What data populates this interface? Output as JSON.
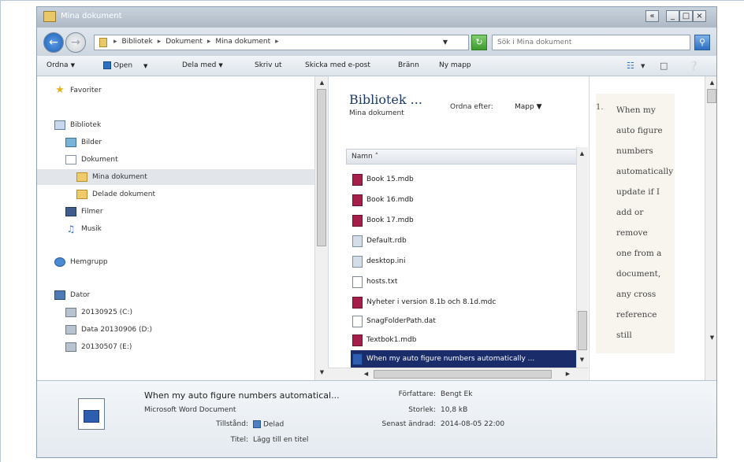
{
  "window": {
    "title": "Mina dokument",
    "buttons": {
      "extra": "«",
      "minimize": "_",
      "maximize": "□",
      "close": "×"
    }
  },
  "address": {
    "crumbs": [
      "Bibliotek",
      "Dokument",
      "Mina dokument"
    ],
    "separator": "▸",
    "dropdown": "▼",
    "search_placeholder": "Sök i Mina dokument"
  },
  "toolbar": {
    "organize": "Ordna",
    "open": "Open",
    "share": "Dela med",
    "print": "Skriv ut",
    "email": "Skicka med e-post",
    "burn": "Bränn",
    "new_folder": "Ny mapp",
    "arrow": "▼"
  },
  "nav": {
    "favorites": "Favoriter",
    "libraries": "Bibliotek",
    "pictures": "Bilder",
    "documents": "Dokument",
    "my_documents": "Mina dokument",
    "shared_documents": "Delade dokument",
    "videos": "Filmer",
    "music": "Musik",
    "homegroup": "Hemgrupp",
    "computer": "Dator",
    "drives": [
      "20130925 (C:)",
      "Data 20130906 (D:)",
      "20130507 (E:)"
    ]
  },
  "filelist": {
    "library_title": "Bibliotek ...",
    "library_subtitle": "Mina dokument",
    "arrange_label": "Ordna efter:",
    "arrange_value": "Mapp ▼",
    "column_name": "Namn",
    "sort_arrow": "˄",
    "files": [
      {
        "name": "Book 15.mdb",
        "type": "mdb"
      },
      {
        "name": "Book 16.mdb",
        "type": "mdb"
      },
      {
        "name": "Book 17.mdb",
        "type": "mdb"
      },
      {
        "name": "Default.rdb",
        "type": "ini"
      },
      {
        "name": "desktop.ini",
        "type": "ini"
      },
      {
        "name": "hosts.txt",
        "type": "txt"
      },
      {
        "name": "Nyheter i version 8.1b och 8.1d.mdc",
        "type": "mdb"
      },
      {
        "name": "SnagFolderPath.dat",
        "type": "dat"
      },
      {
        "name": "Textbok1.mdb",
        "type": "mdb"
      },
      {
        "name": "When my auto figure numbers automatically ...",
        "type": "doc"
      }
    ]
  },
  "preview": {
    "number": "1.",
    "lines": [
      "When my",
      "auto figure",
      "numbers",
      "automatically",
      "update if I",
      "add or",
      "remove",
      "one from a",
      "document,",
      "any cross",
      "reference",
      "still"
    ]
  },
  "details": {
    "name": "When my auto figure numbers automatical...",
    "type": "Microsoft Word Document",
    "shared_label": "Tillstånd:",
    "shared_value": "Delad",
    "title_label": "Titel:",
    "title_value": "Lägg till en titel",
    "author_label": "Författare:",
    "author_value": "Bengt Ek",
    "size_label": "Storlek:",
    "size_value": "10,8 kB",
    "modified_label": "Senast ändrad:",
    "modified_value": "2014-08-05 22:00"
  },
  "scroll": {
    "up": "▲",
    "down": "▼",
    "left": "◀",
    "right": "▶"
  }
}
